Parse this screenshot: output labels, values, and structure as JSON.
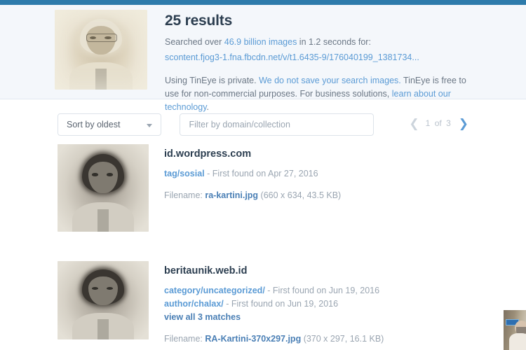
{
  "topbar": {
    "color": "#2e7bab"
  },
  "header": {
    "results_count": "25 results",
    "searched_prefix": "Searched over ",
    "searched_count": "46.9 billion images",
    "searched_suffix": " in 1.2 seconds for:",
    "query_url": "scontent.fjog3-1.fna.fbcdn.net/v/t1.6435-9/176040199_1381734...",
    "privacy_part1": "Using TinEye is private. ",
    "privacy_link1": "We do not save your search images.",
    "privacy_part2": " TinEye is free to use for non-commercial purposes. For business solutions, ",
    "privacy_link2": "learn about our technology",
    "privacy_part3": ".",
    "query_image_alt": "sepia-portrait-thumbnail"
  },
  "controls": {
    "sort_label": "Sort by oldest",
    "sort_caret_icon": "chevron-down-icon",
    "filter_placeholder": "Filter by domain/collection",
    "filter_value": "",
    "pager": {
      "prev_icon": "chevron-left-icon",
      "next_icon": "chevron-right-icon",
      "current_page": "1",
      "of_label": "of",
      "total_pages": "3"
    }
  },
  "results": [
    {
      "domain": "id.wordpress.com",
      "thumb_alt": "grayscale-portrait-thumbnail",
      "matches": [
        {
          "path": "tag/sosial",
          "found": " - First found on Apr 27, 2016"
        }
      ],
      "view_all": "",
      "filename_label": "Filename: ",
      "filename": "ra-kartini.jpg",
      "file_meta": " (660 x 634, 43.5 KB)"
    },
    {
      "domain": "beritaunik.web.id",
      "thumb_alt": "grayscale-portrait-thumbnail",
      "matches": [
        {
          "path": "category/uncategorized/",
          "found": " - First found on Jun 19, 2016"
        },
        {
          "path": "author/chalax/",
          "found": " - First found on Jun 19, 2016"
        }
      ],
      "view_all": "view all 3 matches",
      "filename_label": "Filename: ",
      "filename": "RA-Kartini-370x297.jpg",
      "file_meta": " (370 x 297, 16.1 KB)"
    }
  ],
  "overlay": {
    "name": "webcam-video-overlay"
  },
  "colors": {
    "accent_blue": "#5b9bd5",
    "link_blue": "#4a7fb5",
    "topbar_blue": "#2e7bab",
    "heading_navy": "#2c3e50",
    "muted_gray": "#9aa5b1",
    "band_bg": "#f4f7fb"
  }
}
